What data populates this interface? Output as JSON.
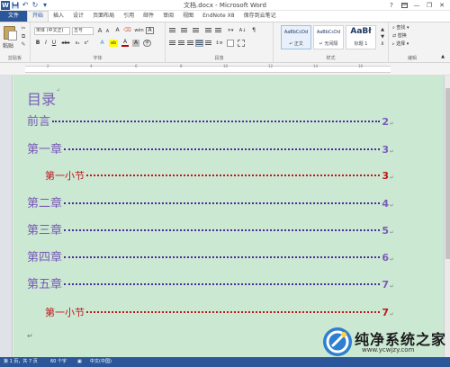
{
  "window": {
    "title": "文档.docx - Microsoft Word",
    "help_glyph": "?",
    "minimize": "—",
    "restore": "❐",
    "close": "✕"
  },
  "qat": {
    "app_icon": "W",
    "save_icon": "💾",
    "undo_icon": "↶",
    "redo_icon": "↻",
    "custom_icon": "▾"
  },
  "tabs": [
    {
      "label": "文件"
    },
    {
      "label": "开始"
    },
    {
      "label": "插入"
    },
    {
      "label": "设计"
    },
    {
      "label": "页面布局"
    },
    {
      "label": "引用"
    },
    {
      "label": "邮件"
    },
    {
      "label": "审阅"
    },
    {
      "label": "视图"
    },
    {
      "label": "EndNote X8"
    },
    {
      "label": "保存到云笔记"
    }
  ],
  "active_tab": "开始",
  "ribbon": {
    "clipboard": {
      "paste": "粘贴",
      "label": "剪贴板"
    },
    "font": {
      "font_name": "宋体 (中文正)",
      "font_size": "五号",
      "label": "字体",
      "bold": "B",
      "italic": "I",
      "underline": "U",
      "strike": "abc",
      "subscript": "x₂",
      "superscript": "x²",
      "grow": "A",
      "shrink": "A",
      "clear": "A",
      "phonetic": "wén",
      "border": "A",
      "highlight": "ab",
      "color": "A",
      "char_shade": "A",
      "circled": "字"
    },
    "paragraph": {
      "label": "段落",
      "pilcrow": "¶"
    },
    "styles": {
      "label": "样式",
      "items": [
        {
          "sample": "AaBbCcDd",
          "name": "↵ 正文"
        },
        {
          "sample": "AaBbCcDd",
          "name": "↵ 无间隔"
        },
        {
          "sample": "AaBł",
          "name": "标题 1"
        }
      ]
    },
    "editing": {
      "label": "编辑",
      "find": "查找 ▾",
      "replace": "替换",
      "select": "选择 ▾"
    }
  },
  "document": {
    "heading": "目录",
    "entries": [
      {
        "title": "前言",
        "page": "2",
        "level": 1
      },
      {
        "title": "第一章",
        "page": "3",
        "level": 1
      },
      {
        "title": "第一小节",
        "page": "3",
        "level": 2
      },
      {
        "title": "第二章",
        "page": "4",
        "level": 1
      },
      {
        "title": "第三章",
        "page": "5",
        "level": 1
      },
      {
        "title": "第四章",
        "page": "6",
        "level": 1
      },
      {
        "title": "第五章",
        "page": "7",
        "level": 1
      },
      {
        "title": "第一小节",
        "page": "7",
        "level": 2
      }
    ],
    "para_mark": "↵",
    "colors": {
      "level1": "#7a5ab8",
      "level2": "#c0171a",
      "page_bg": "#cbe8d3",
      "accent": "#2b579a"
    }
  },
  "status": {
    "page": "第 1 页，共 7 页",
    "words": "60 个字",
    "language": "中文(中国)"
  },
  "watermark": {
    "title": "纯净系统之家",
    "url": "www.ycwjzy.com"
  }
}
